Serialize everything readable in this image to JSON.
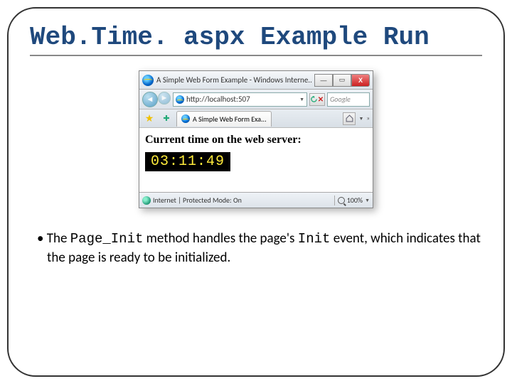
{
  "slide": {
    "title": "Web.Time. aspx Example Run"
  },
  "browser": {
    "window_title": "A Simple Web Form Example - Windows Interne...",
    "url": "http://localhost:507",
    "search_placeholder": "Google",
    "tab_title": "A Simple Web Form Exa...",
    "page_heading": "Current time on the web server:",
    "time_value": "03:11:49",
    "status_text": "Internet | Protected Mode: On",
    "zoom": "100%"
  },
  "bullet": {
    "pre": "The ",
    "code1": "Page_Init",
    "mid": " method handles the page's ",
    "code2": "Init",
    "post": " event, which indicates that the page is ready to be initialized."
  }
}
